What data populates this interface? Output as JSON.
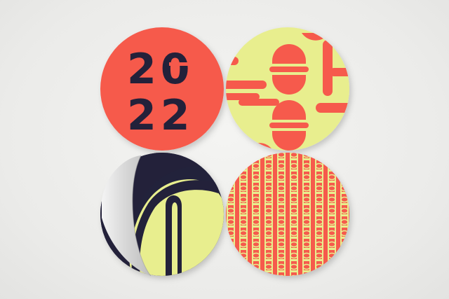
{
  "stickers": {
    "top_left": {
      "year_top": "20",
      "year_bottom": "22"
    }
  },
  "colors": {
    "background": "#ececea",
    "coral": "#f65a4c",
    "yellow": "#e8ee8e",
    "navy": "#23213a",
    "peel_back": "#dcdcdc"
  },
  "icons": [
    "year-sticker",
    "s-pattern-sticker",
    "peeled-arch-sticker",
    "chain-pattern-sticker"
  ]
}
